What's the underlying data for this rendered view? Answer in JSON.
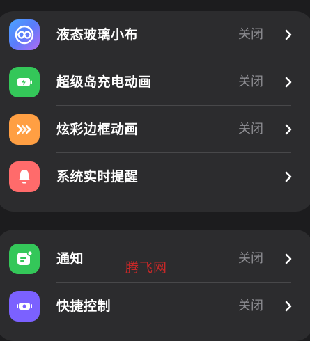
{
  "settings_group_1": [
    {
      "label": "液态玻璃小布",
      "value": "关闭",
      "icon": "infinity-icon",
      "icon_color": "#5b7cfa"
    },
    {
      "label": "超级岛充电动画",
      "value": "关闭",
      "icon": "battery-charging-icon",
      "icon_color": "#34c759"
    },
    {
      "label": "炫彩边框动画",
      "value": "关闭",
      "icon": "chevrons-right-icon",
      "icon_color": "#ff9f43"
    },
    {
      "label": "系统实时提醒",
      "value": "",
      "icon": "bell-icon",
      "icon_color": "#ff6b6b"
    }
  ],
  "settings_group_2": [
    {
      "label": "通知",
      "value": "关闭",
      "icon": "notification-icon",
      "icon_color": "#34c759"
    },
    {
      "label": "快捷控制",
      "value": "关闭",
      "icon": "quick-control-icon",
      "icon_color": "#7b61ff"
    }
  ],
  "watermark": "腾飞网",
  "colors": {
    "background": "#1c1c1e",
    "card": "#2c2c2e",
    "text": "#ffffff",
    "secondary_text": "#8e8e93",
    "divider": "#48484a"
  }
}
